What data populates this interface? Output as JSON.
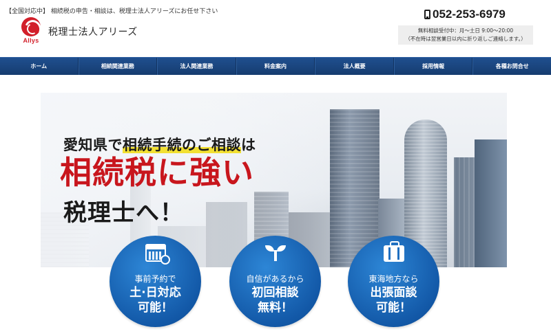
{
  "header": {
    "tagline": "【全国対応中】 相続税の申告・相談は、税理士法人アリーズにお任せ下さい",
    "logo_text": "Allys",
    "company_name": "税理士法人アリーズ",
    "phone": "052-253-6979",
    "hours_line1": "無料相談受付中：月〜土日 9:00〜20:00",
    "hours_line2": "（不在時は翌営業日以内に折り返しご連絡します。）"
  },
  "nav": {
    "items": [
      {
        "label": "ホーム"
      },
      {
        "label": "相続関連業務"
      },
      {
        "label": "法人関連業務"
      },
      {
        "label": "料金案内"
      },
      {
        "label": "法人概要"
      },
      {
        "label": "採用情報"
      },
      {
        "label": "各種お問合せ"
      }
    ]
  },
  "hero": {
    "line1_prefix": "愛知県で",
    "line1_highlight": "相続手続のご相談",
    "line1_suffix": "は",
    "line2": "相続税に強い",
    "line3": "税理士へ！"
  },
  "features": [
    {
      "icon": "calendar-clock-icon",
      "small": "事前予約で",
      "big1": "土·日対応",
      "big2": "可能！"
    },
    {
      "icon": "sprout-icon",
      "small": "自信があるから",
      "big1": "初回相談",
      "big2": "無料！"
    },
    {
      "icon": "suitcase-icon",
      "small": "東海地方なら",
      "big1": "出張面談",
      "big2": "可能！"
    }
  ],
  "colors": {
    "nav_bg": "#1a4682",
    "brand_red": "#c8161d",
    "circle_blue": "#1359a8",
    "highlight_yellow": "#f2e033"
  }
}
